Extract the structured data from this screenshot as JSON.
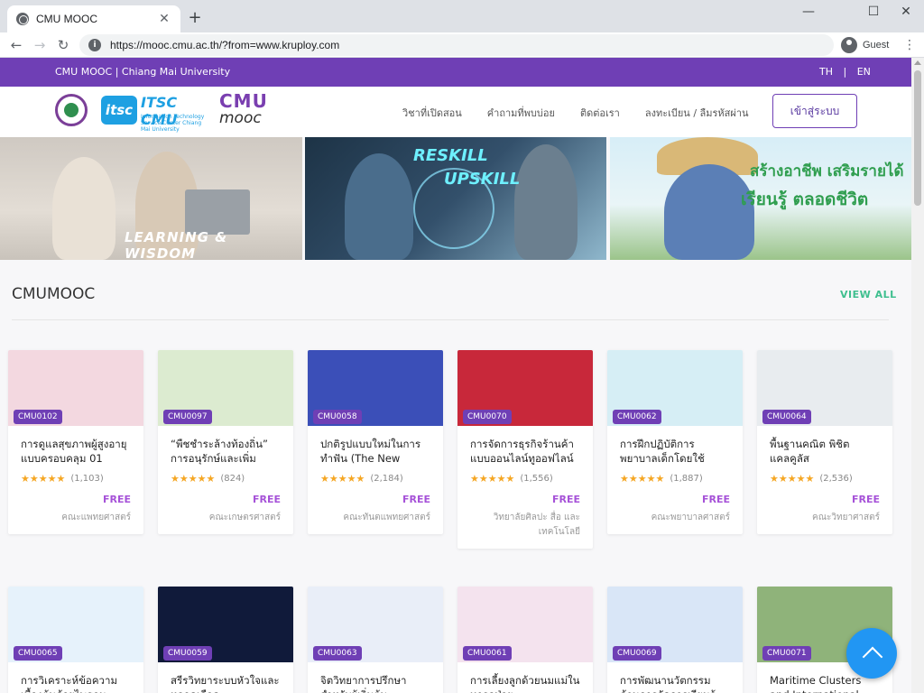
{
  "browser": {
    "tab_title": "CMU MOOC",
    "tab_close": "✕",
    "new_tab": "+",
    "url": "https://mooc.cmu.ac.th/?from=www.kruploy.com",
    "profile": "Guest",
    "minimize": "—",
    "maximize": "☐",
    "close": "✕",
    "back": "←",
    "forward": "→",
    "reload": "↻",
    "menu": "⋮"
  },
  "topbar": {
    "university": "CMU MOOC | Chiang Mai University",
    "lang_th": "TH",
    "lang_sep": "|",
    "lang_en": "EN"
  },
  "header": {
    "itsc_badge": "itsc",
    "itsc_text": "ITSC CMU",
    "itsc_sub": "Information Technology Service Center Chiang Mai University",
    "cmu_text": "CMU",
    "mooc_text": "mooc",
    "nav": [
      "วิชาที่เปิดสอน",
      "คำถามที่พบบ่อย",
      "ติดต่อเรา",
      "ลงทะเบียน / ลืมรหัสผ่าน"
    ],
    "login": "เข้าสู่ระบบ"
  },
  "banners": {
    "b1_text": "LEARNING & WISDOM",
    "b2_text1": "RESKILL",
    "b2_text2": "UPSKILL",
    "b3_text1": "สร้างอาชีพ เสริมรายได้",
    "b3_text2": "เรียนรู้  ตลอดชีวิต"
  },
  "section": {
    "title": "CMUMOOC",
    "view_all": "VIEW ALL"
  },
  "courses": [
    {
      "code": "CMU0102",
      "title": "การดูแลสุขภาพผู้สูงอายุแบบครอบคลุม 01",
      "stars": "★★★★★",
      "count": "(1,103)",
      "price": "FREE",
      "faculty": "คณะแพทยศาสตร์",
      "thumb_color": "#f3d8e0"
    },
    {
      "code": "CMU0097",
      "title": "“พืชชำระล้างท้องถิ่น” การอนุรักษ์และเพิ่ม",
      "stars": "★★★★★",
      "count": "(824)",
      "price": "FREE",
      "faculty": "คณะเกษตรศาสตร์",
      "thumb_color": "#dcebd0"
    },
    {
      "code": "CMU0058",
      "title": "ปกติรูปแบบใหม่ในการทำฟัน (The New",
      "stars": "★★★★★",
      "count": "(2,184)",
      "price": "FREE",
      "faculty": "คณะทันตแพทยศาสตร์",
      "thumb_color": "#3b4fb8"
    },
    {
      "code": "CMU0070",
      "title": "การจัดการธุรกิจร้านค้าแบบออนไลน์ทูออฟไลน์",
      "stars": "★★★★★",
      "count": "(1,556)",
      "price": "FREE",
      "faculty": "วิทยาลัยศิลปะ สื่อ และเทคโนโลยี",
      "thumb_color": "#c8283a"
    },
    {
      "code": "CMU0062",
      "title": "การฝึกปฏิบัติการพยาบาลเด็กโดยใช้",
      "stars": "★★★★★",
      "count": "(1,887)",
      "price": "FREE",
      "faculty": "คณะพยาบาลศาสตร์",
      "thumb_color": "#d6eef5"
    },
    {
      "code": "CMU0064",
      "title": "พื้นฐานคณิต พิชิตแคลคูลัส",
      "stars": "★★★★★",
      "count": "(2,536)",
      "price": "FREE",
      "faculty": "คณะวิทยาศาสตร์",
      "thumb_color": "#e8ecef"
    },
    {
      "code": "CMU0065",
      "title": "การวิเคราะห์ข้อความเบื้องต้นด้วยไพธอน",
      "thumb_color": "#e6f2fb"
    },
    {
      "code": "CMU0059",
      "title": "สรีรวิทยาระบบหัวใจและหลอดเลือด",
      "thumb_color": "#101a3a"
    },
    {
      "code": "CMU0063",
      "title": "จิตวิทยาการปรึกษาสำหรับผู้เริ่มต้น",
      "thumb_color": "#e9eef8"
    },
    {
      "code": "CMU0061",
      "title": "การเลี้ยงลูกด้วยนมแม่ในทารกป่วย",
      "thumb_color": "#f4e3ee"
    },
    {
      "code": "CMU0069",
      "title": "การพัฒนานวัตกรรมด้านการจัดการเรียนรู้",
      "thumb_color": "#d9e6f7"
    },
    {
      "code": "CMU0071",
      "title": "Maritime Clusters and International",
      "thumb_color": "#8fb37a"
    }
  ]
}
